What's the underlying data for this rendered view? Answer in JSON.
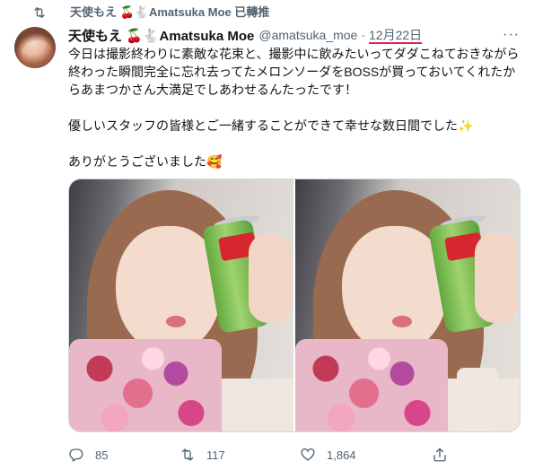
{
  "retweet_context": {
    "text": "天使もえ 🍒🐇Amatsuka Moe 已轉推"
  },
  "tweet": {
    "display_name": "天使もえ 🍒🐇Amatsuka Moe",
    "handle": "@amatsuka_moe",
    "separator": "·",
    "date": "12月22日",
    "more_label": "···",
    "text": {
      "p1": "今日は撮影終わりに素敵な花束と、撮影中に飲みたいってダダこねておきながら終わった瞬間完全に忘れ去ってたメロンソーダをBOSSが買っておいてくれたからあまつかさん大満足でしあわせるんたったです！",
      "p2": "優しいスタッフの皆様とご一緒することができて幸せな数日間でした✨",
      "p3": "ありがとうございました🥰"
    },
    "actions": {
      "reply_count": "85",
      "retweet_count": "117",
      "like_count": "1,864"
    }
  },
  "icons": {
    "retweet": "retweet-icon",
    "reply": "reply-icon",
    "like": "heart-icon",
    "share": "share-icon",
    "more": "more-icon"
  },
  "colors": {
    "secondary_text": "#536471",
    "primary_text": "#0f1419",
    "date_underline": "#e0245e"
  }
}
